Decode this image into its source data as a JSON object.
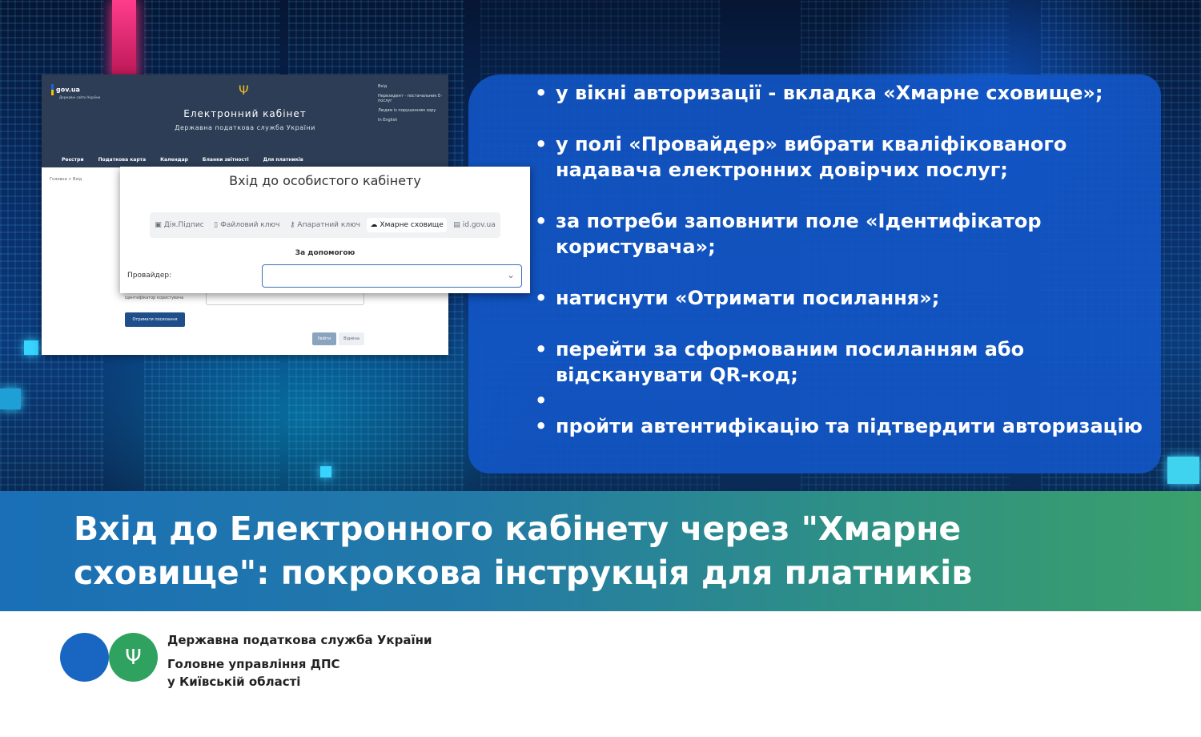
{
  "steps": [
    "у вікні авторизації - вкладка «Хмарне сховище»;",
    "у полі «Провайдер» вибрати кваліфікованого надавача електронних довірчих послуг;",
    "за потреби заповнити поле «Ідентифікатор користувача»;",
    "натиснути «Отримати посилання»;",
    "перейти за сформованим посиланням або відсканувати QR-код;",
    "",
    "пройти автентифікацію та підтвердити авторизацію"
  ],
  "title": "Вхід до Електронного кабінету через \"Хмарне сховище\": покрокова інструкція для платників",
  "footer": {
    "org_line1": "Державна податкова служба України",
    "org_line2": "Головне управління ДПС",
    "org_line3": "у Київській області"
  },
  "cabinet": {
    "gov_logo": "gov.ua",
    "gov_sub": "Державні сайти України",
    "title": "Електронний кабінет",
    "subtitle": "Державна податкова служба України",
    "links": [
      "Вхід",
      "Нерезидент - постачальник Е-послуг",
      "Людям із порушенням зору",
      "In English"
    ],
    "nav": [
      "Реєстри",
      "Податкова карта",
      "Календар",
      "Бланки звітності",
      "Для платників"
    ],
    "breadcrumb": "Головна  >  Вхід",
    "user_id_label": "Ідентифікатор користувача",
    "get_link_button": "Отримати посилання",
    "login_button": "Увійти",
    "cancel_button": "Відміна"
  },
  "dialog": {
    "title": "Вхід до особистого кабінету",
    "tabs": [
      "Дія.Підпис",
      "Файловий ключ",
      "Апаратний ключ",
      "Хмарне сховище",
      "id.gov.ua"
    ],
    "active_tab": "Хмарне сховище",
    "help_text": "За допомогою",
    "provider_label": "Провайдер:",
    "provider_value": ""
  },
  "colors": {
    "panel": "#1256c8",
    "title_band_start": "#1a6fb6",
    "title_band_end": "#3aa06b",
    "logo_blue": "#1966c2",
    "logo_green": "#2ea25e"
  }
}
